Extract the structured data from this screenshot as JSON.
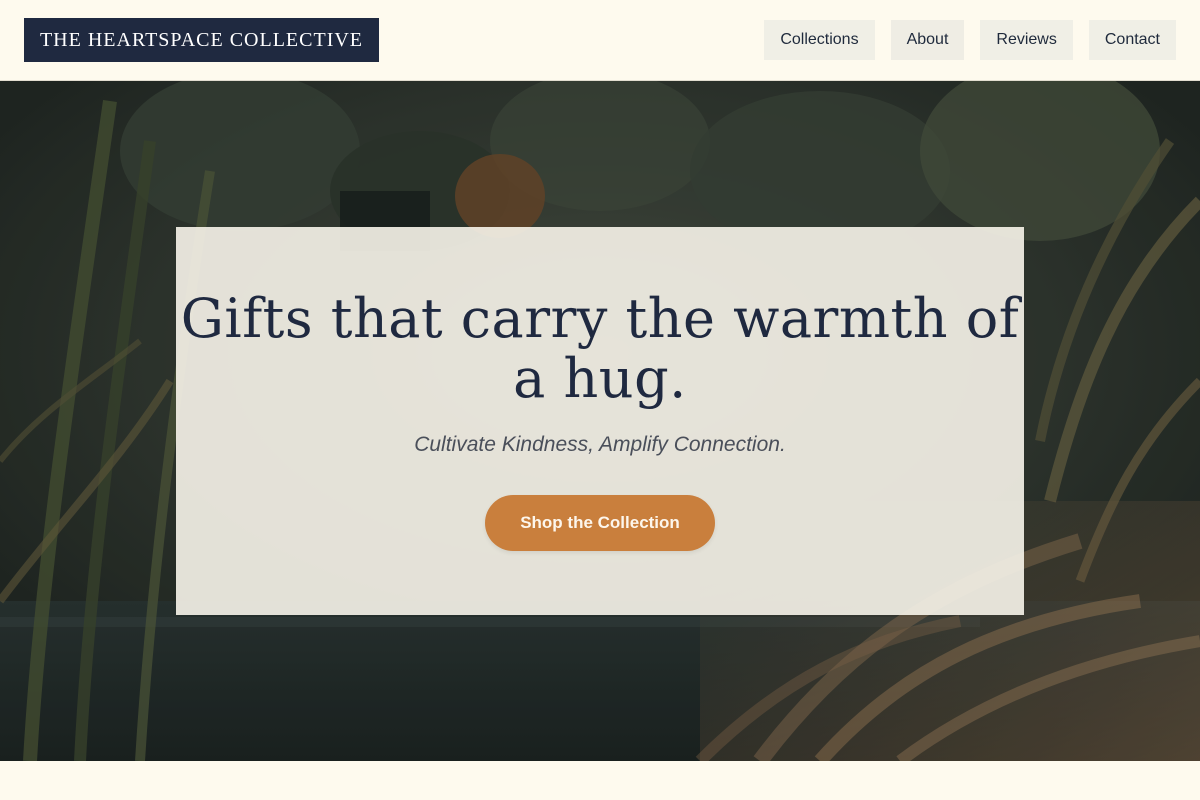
{
  "header": {
    "logo_text": "THE HEARTSPACE COLLECTIVE",
    "nav": [
      {
        "label": "Collections"
      },
      {
        "label": "About"
      },
      {
        "label": "Reviews"
      },
      {
        "label": "Contact"
      }
    ]
  },
  "hero": {
    "title": "Gifts that carry the warmth of a hug.",
    "subtitle": "Cultivate Kindness, Amplify Connection.",
    "cta_label": "Shop the Collection"
  },
  "colors": {
    "page_background": "#fefaee",
    "logo_background": "#1f2940",
    "nav_button_background": "#f0efe6",
    "cta_background": "#c97f3d",
    "heading_color": "#1f2940"
  }
}
